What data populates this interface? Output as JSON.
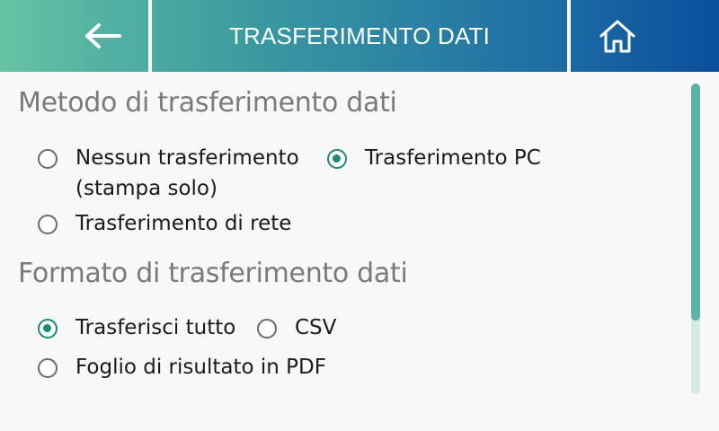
{
  "header": {
    "title": "TRASFERIMENTO DATI",
    "back_icon": "arrow-left-icon",
    "home_icon": "home-icon",
    "gradient_colors": [
      "#66c2a3",
      "#0a4f9c"
    ]
  },
  "sections": [
    {
      "title": "Metodo di trasferimento dati",
      "options": [
        {
          "label_line1": "Nessun trasferimento",
          "label_line2": "(stampa solo)",
          "selected": false
        },
        {
          "label_line1": "Trasferimento PC",
          "selected": true
        },
        {
          "label_line1": "Trasferimento di rete",
          "selected": false
        }
      ]
    },
    {
      "title": "Formato di trasferimento dati",
      "options": [
        {
          "label_line1": "Trasferisci tutto",
          "selected": true
        },
        {
          "label_line1": "CSV",
          "selected": false
        },
        {
          "label_line1": "Foglio di risultato in PDF",
          "selected": false
        }
      ]
    }
  ],
  "colors": {
    "accent": "#1d8a72",
    "scroll_thumb": "#5ab3a3",
    "scroll_track": "#d2ebe3"
  }
}
